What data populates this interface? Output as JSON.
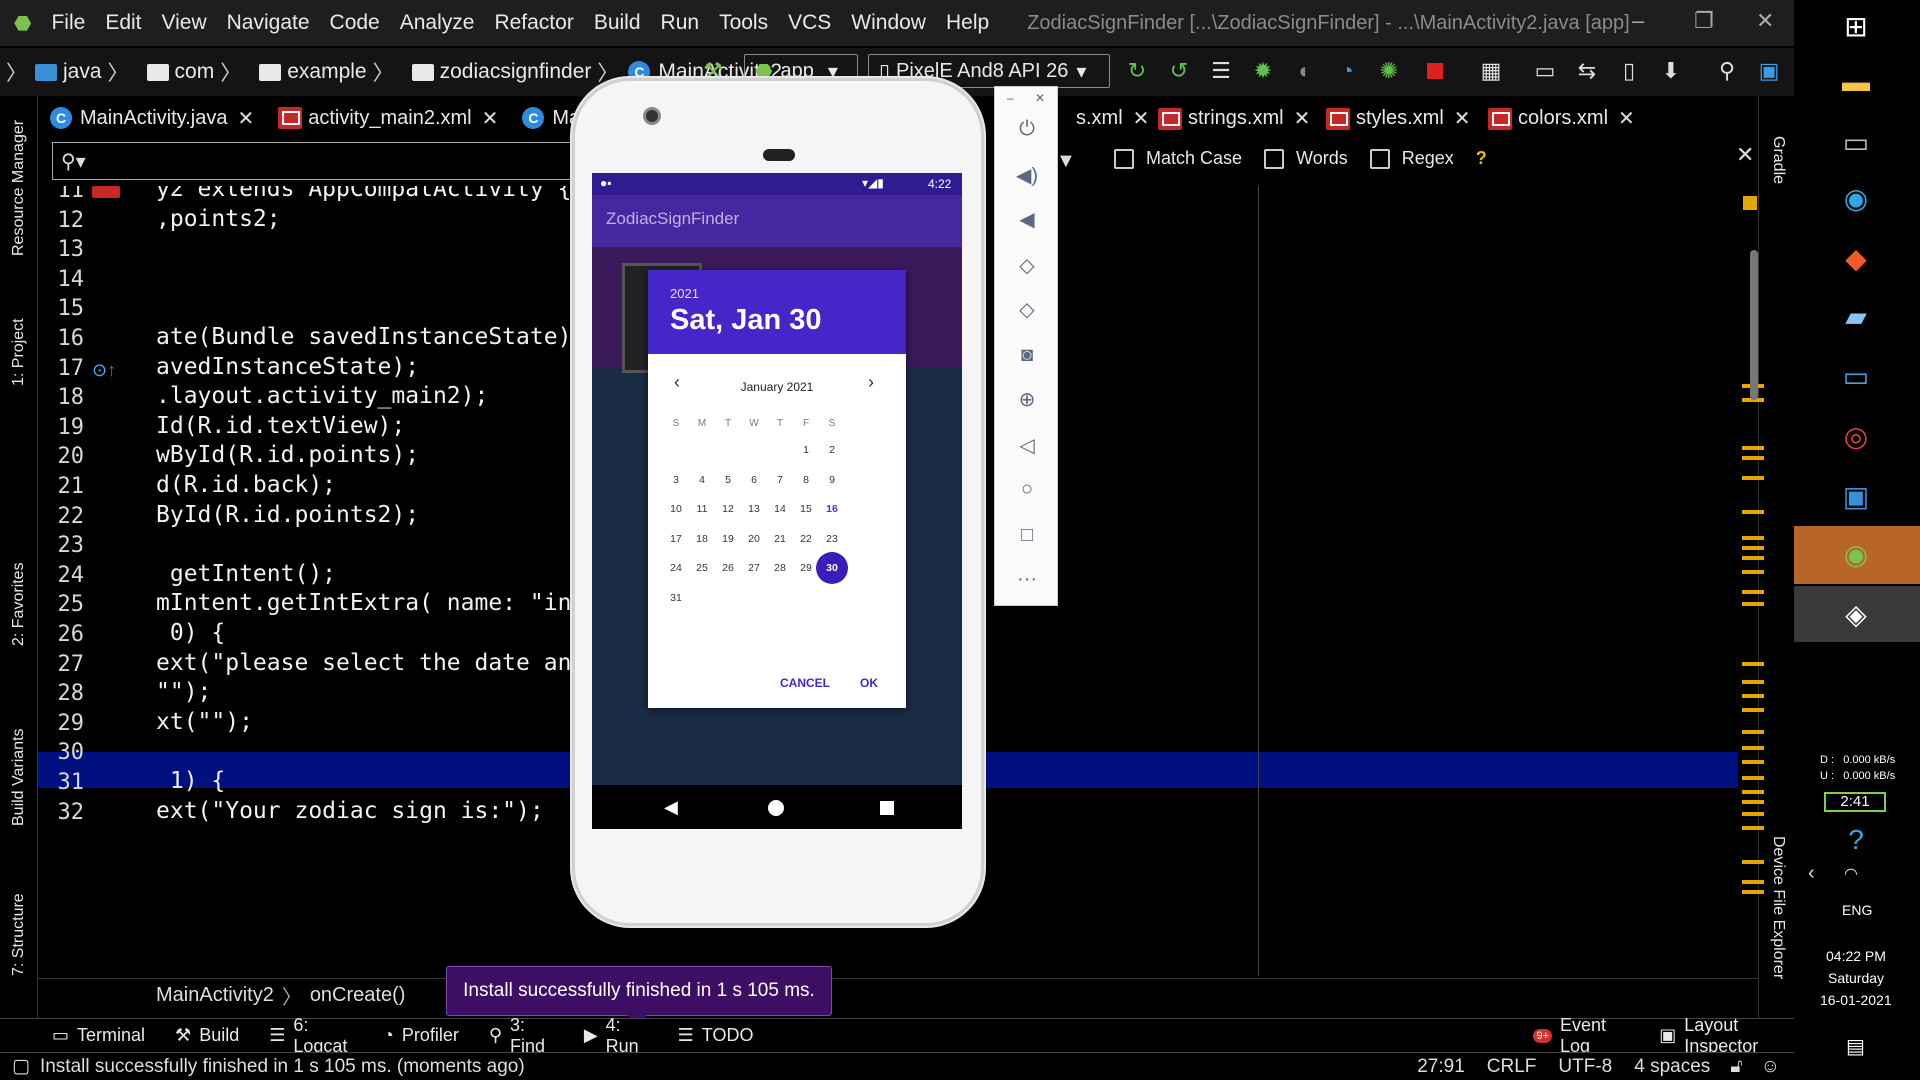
{
  "menu": {
    "items": [
      "File",
      "Edit",
      "View",
      "Navigate",
      "Code",
      "Analyze",
      "Refactor",
      "Build",
      "Run",
      "Tools",
      "VCS",
      "Window",
      "Help"
    ],
    "window_title": "ZodiacSignFinder [...\\ZodiacSignFinder] - ...\\MainActivity2.java [app]"
  },
  "nav": {
    "crumbs": [
      "java",
      "com",
      "example",
      "zodiacsignfinder",
      "MainActivity2"
    ],
    "run_config": "app",
    "device": "PixelE And8 API 26"
  },
  "tabs": [
    "MainActivity.java",
    "activity_main2.xml",
    "Mai",
    "s.xml",
    "strings.xml",
    "styles.xml",
    "colors.xml"
  ],
  "find": {
    "match_case": "Match Case",
    "words": "Words",
    "regex": "Regex",
    "help": "?"
  },
  "left_tools": [
    "Resource Manager",
    "1: Project",
    "2: Favorites",
    "Build Variants",
    "7: Structure"
  ],
  "right_tools": [
    "Gradle",
    "Device File Explorer"
  ],
  "editor": {
    "lines": [
      {
        "n": "11",
        "text": "y2 extends AppCompatActivity {"
      },
      {
        "n": "12",
        "text": ",points2;"
      },
      {
        "n": "13",
        "text": ""
      },
      {
        "n": "14",
        "text": ""
      },
      {
        "n": "15",
        "text": ""
      },
      {
        "n": "16",
        "text": "ate(Bundle savedInstanceState)"
      },
      {
        "n": "17",
        "text": "avedInstanceState);"
      },
      {
        "n": "18",
        "text": ".layout.activity_main2);"
      },
      {
        "n": "19",
        "text": "Id(R.id.textView);"
      },
      {
        "n": "20",
        "text": "wById(R.id.points);"
      },
      {
        "n": "21",
        "text": "d(R.id.back);"
      },
      {
        "n": "22",
        "text": "ById(R.id.points2);"
      },
      {
        "n": "23",
        "text": ""
      },
      {
        "n": "24",
        "text": " getIntent();"
      },
      {
        "n": "25",
        "text": "mIntent.getIntExtra( name: \"int"
      },
      {
        "n": "26",
        "text": " 0) {"
      },
      {
        "n": "27",
        "text": "ext(\"please select the date an              ac sign\");"
      },
      {
        "n": "28",
        "text": "\"\");"
      },
      {
        "n": "29",
        "text": "xt(\"\");"
      },
      {
        "n": "30",
        "text": ""
      },
      {
        "n": "31",
        "text": " 1) {"
      },
      {
        "n": "32",
        "text": "ext(\"Your zodiac sign is:\");"
      }
    ],
    "hint_name": "name:"
  },
  "breadcrumb": {
    "class": "MainActivity2",
    "method": "onCreate()"
  },
  "toast": "Install successfully finished in 1 s 105 ms.",
  "toolwindows": {
    "left": [
      "Terminal",
      "Build",
      "6: Logcat",
      "Profiler",
      "3: Find",
      "4: Run",
      "TODO"
    ],
    "right": [
      "Event Log",
      "Layout Inspector"
    ],
    "event_badge": "9+"
  },
  "status": {
    "message": "Install successfully finished in 1 s 105 ms. (moments ago)",
    "position": "27:91",
    "line_sep": "CRLF",
    "encoding": "UTF-8",
    "indent": "4 spaces"
  },
  "emulator": {
    "time": "4:22",
    "app_title": "ZodiacSignFinder",
    "dialog": {
      "year": "2021",
      "date": "Sat, Jan 30",
      "month": "January 2021",
      "weekdays": [
        "S",
        "M",
        "T",
        "W",
        "T",
        "F",
        "S"
      ],
      "days": [
        "1",
        "2",
        "3",
        "4",
        "5",
        "6",
        "7",
        "8",
        "9",
        "10",
        "11",
        "12",
        "13",
        "14",
        "15",
        "16",
        "17",
        "18",
        "19",
        "20",
        "21",
        "22",
        "23",
        "24",
        "25",
        "26",
        "27",
        "28",
        "29",
        "30",
        "31"
      ],
      "cancel": "CANCEL",
      "ok": "OK"
    }
  },
  "taskbar": {
    "net_d": "D :   0.000 kB/s",
    "net_u": "U :   0.000 kB/s",
    "battery": "2:41",
    "lang": "ENG",
    "time": "04:22 PM",
    "day": "Saturday",
    "date": "16-01-2021"
  },
  "colors": {
    "accent": "#4527c9",
    "current_line": "#001080",
    "highlight": "#8a4c00",
    "toast": "#3c0e64"
  }
}
